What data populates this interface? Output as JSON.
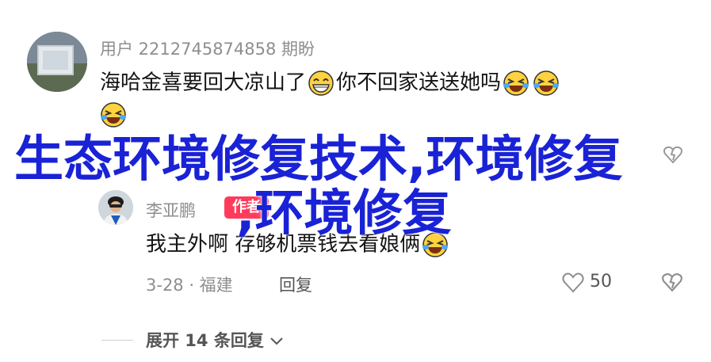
{
  "main_comment": {
    "username": "用户 2212745874858 期盼",
    "text_before_emoji": "海哈金喜要回大凉山了",
    "text_after_emoji": "你不回家送送她吗"
  },
  "overlay": {
    "line1": "生态环境修复技术,环境修复",
    "line2": ",环境修复"
  },
  "reply": {
    "username": "李亚鹏",
    "badge": "作者",
    "text": "我主外啊 存够机票钱去看娘俩",
    "date_location": "3-28 · 福建",
    "reply_label": "回复",
    "like_count": "50"
  },
  "expand": {
    "label": "展开 14 条回复"
  },
  "colors": {
    "overlay_text": "#1a22d6",
    "author_badge": "#ff3b5c"
  }
}
